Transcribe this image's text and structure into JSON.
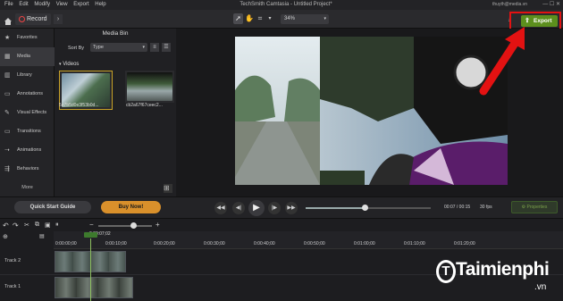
{
  "menu": [
    "File",
    "Edit",
    "Modify",
    "View",
    "Export",
    "Help"
  ],
  "window_title": "TechSmith Camtasia - Untitled Project*",
  "user": "thuyth@media.vn",
  "toolbar": {
    "record_label": "Record",
    "zoom_value": "34%",
    "export_label": "Export"
  },
  "sidebar": {
    "items": [
      {
        "label": "Favorites",
        "icon": "star-icon"
      },
      {
        "label": "Media",
        "icon": "media-icon"
      },
      {
        "label": "Library",
        "icon": "library-icon"
      },
      {
        "label": "Annotations",
        "icon": "annotations-icon"
      },
      {
        "label": "Visual Effects",
        "icon": "visual-effects-icon"
      },
      {
        "label": "Transitions",
        "icon": "transitions-icon"
      },
      {
        "label": "Animations",
        "icon": "animations-icon"
      },
      {
        "label": "Behaviors",
        "icon": "behaviors-icon"
      }
    ],
    "more_label": "More"
  },
  "media_bin": {
    "title": "Media Bin",
    "sort_by_label": "Sort By",
    "sort_value": "Type",
    "group_label": "Videos",
    "items": [
      {
        "name": "5e7b5d0e3f53b0d..."
      },
      {
        "name": "cb2a67f67ceec2..."
      }
    ]
  },
  "playback": {
    "quick_start_label": "Quick Start Guide",
    "buy_now_label": "Buy Now!",
    "time_display": "00:07 / 00:15",
    "fps": "30 fps",
    "properties_label": "Properties",
    "progress": 0.47
  },
  "timeline": {
    "playhead": "0:00:07;02",
    "ruler": [
      "0:00:00;00",
      "0:00:10;00",
      "0:00:20;00",
      "0:00:30;00",
      "0:00:40;00",
      "0:00:50;00",
      "0:01:00;00",
      "0:01:10;00",
      "0:01:20;00"
    ],
    "tracks": [
      "Track 2",
      "Track 1"
    ]
  },
  "watermark": {
    "brand": "Taimienphi",
    "domain": ".vn"
  },
  "colors": {
    "accent_green": "#5c8f1d",
    "buy_orange": "#d9902b",
    "annotation_red": "#e31212"
  }
}
